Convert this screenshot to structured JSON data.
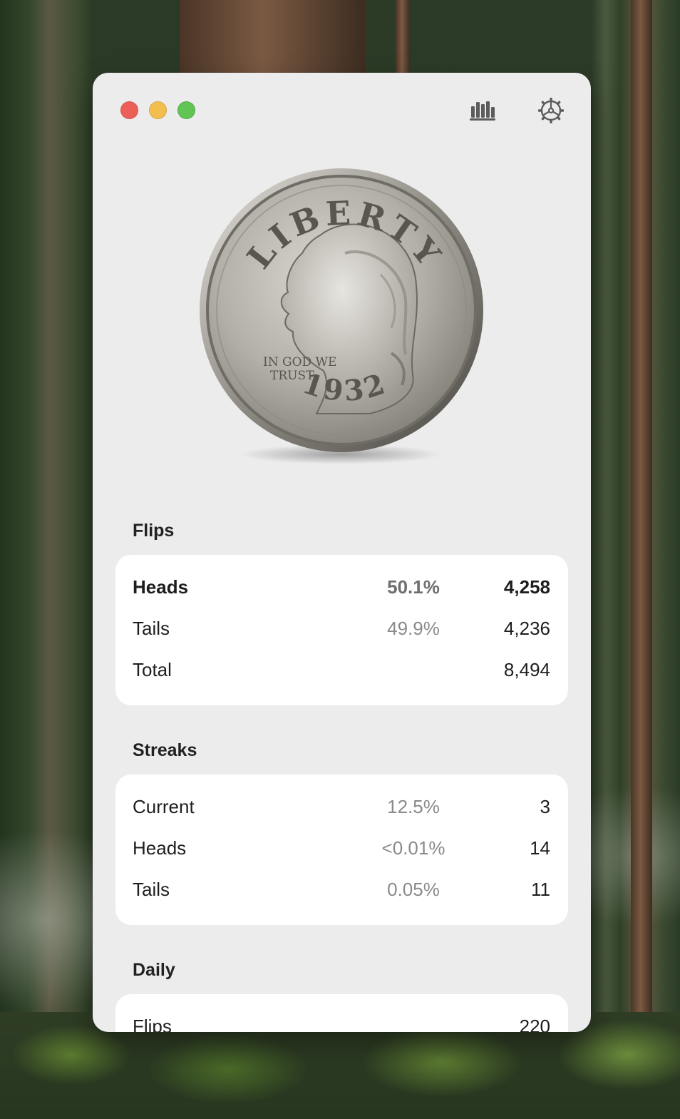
{
  "window": {
    "controls": {
      "close_color": "#ec5f57",
      "minimize_color": "#f4be4f",
      "zoom_color": "#61c454"
    },
    "toolbar": {
      "stats_icon": "bar-chart-icon",
      "settings_icon": "gear-icon"
    }
  },
  "coin": {
    "top_text": "LIBERTY",
    "motto": "IN GOD WE TRUST",
    "motto_line1": "IN GOD WE",
    "motto_line2": "TRUST",
    "year": "1932"
  },
  "flips": {
    "title": "Flips",
    "rows": [
      {
        "label": "Heads",
        "percent": "50.1%",
        "count": "4,258"
      },
      {
        "label": "Tails",
        "percent": "49.9%",
        "count": "4,236"
      },
      {
        "label": "Total",
        "percent": "",
        "count": "8,494"
      }
    ]
  },
  "streaks": {
    "title": "Streaks",
    "rows": [
      {
        "label": "Current",
        "percent": "12.5%",
        "count": "3"
      },
      {
        "label": "Heads",
        "percent": "<0.01%",
        "count": "14"
      },
      {
        "label": "Tails",
        "percent": "0.05%",
        "count": "11"
      }
    ]
  },
  "daily": {
    "title": "Daily",
    "rows": [
      {
        "label": "Flips",
        "percent": "",
        "count": "220"
      }
    ]
  }
}
